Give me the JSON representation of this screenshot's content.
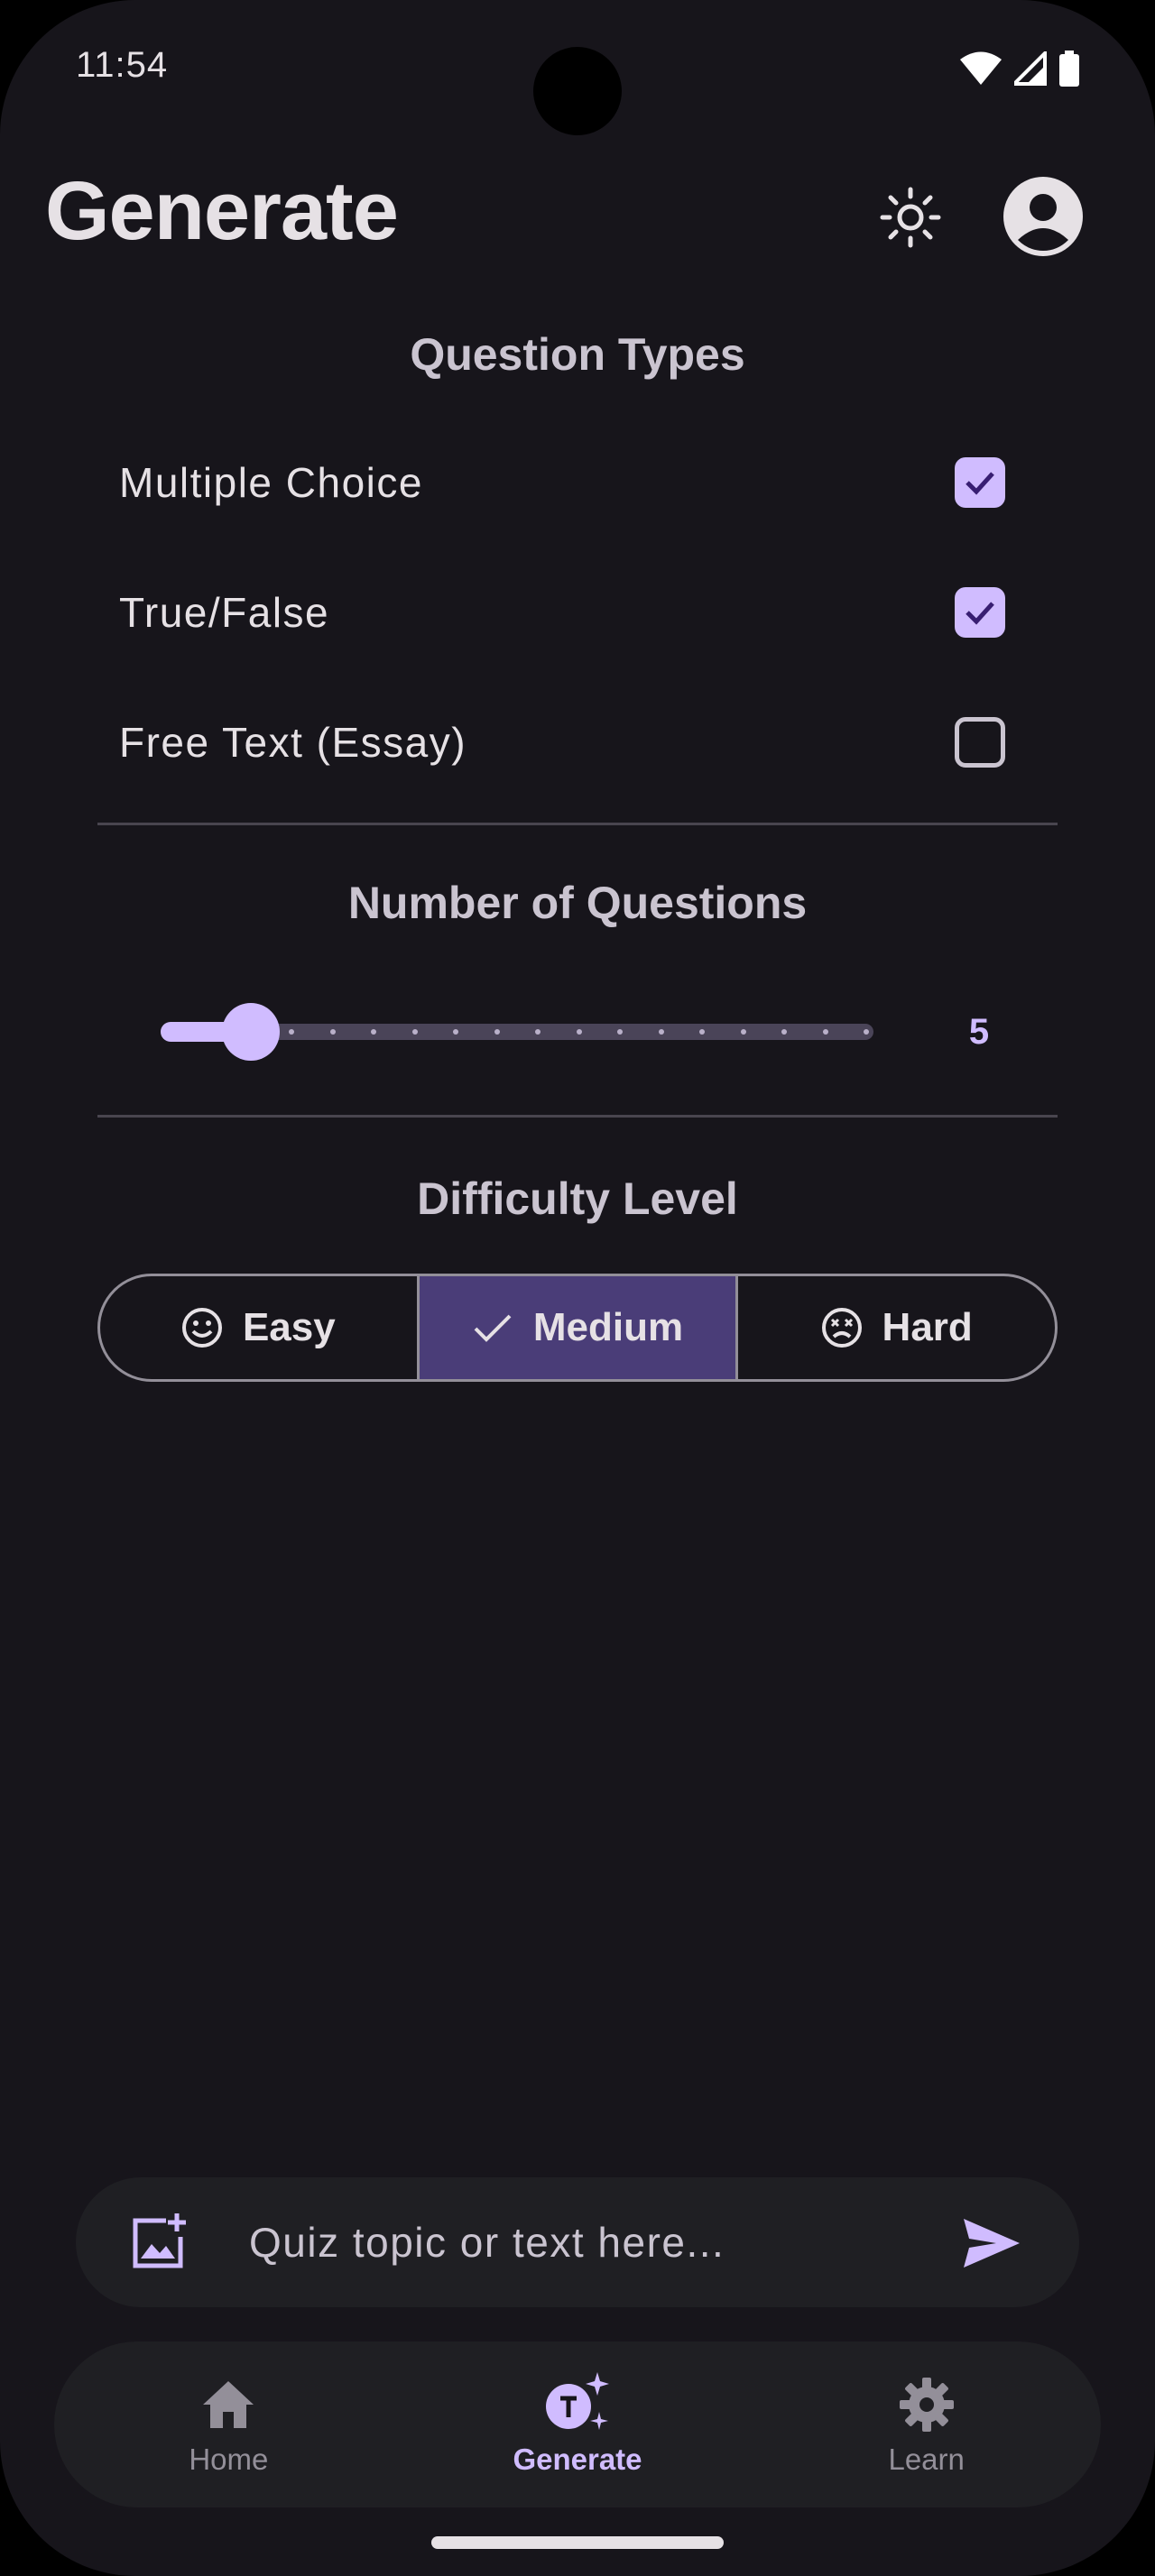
{
  "status_bar": {
    "time": "11:54",
    "icons": [
      "wifi-icon",
      "signal-icon",
      "battery-icon"
    ]
  },
  "header": {
    "title": "Generate",
    "theme_icon": "sun-icon",
    "profile_icon": "account-circle-icon"
  },
  "question_types": {
    "title": "Question Types",
    "options": [
      {
        "label": "Multiple Choice",
        "checked": true
      },
      {
        "label": "True/False",
        "checked": true
      },
      {
        "label": "Free Text (Essay)",
        "checked": false
      }
    ]
  },
  "number_of_questions": {
    "title": "Number of Questions",
    "value": "5",
    "min": 1,
    "max": 20
  },
  "difficulty": {
    "title": "Difficulty Level",
    "options": [
      {
        "label": "Easy",
        "icon": "smile-icon",
        "selected": false
      },
      {
        "label": "Medium",
        "icon": "check-icon",
        "selected": true
      },
      {
        "label": "Hard",
        "icon": "dizzy-face-icon",
        "selected": false
      }
    ]
  },
  "input": {
    "placeholder": "Quiz topic or text here...",
    "value": ""
  },
  "bottom_nav": {
    "items": [
      {
        "label": "Home",
        "icon": "home-icon",
        "active": false
      },
      {
        "label": "Generate",
        "icon": "text-sparkle-icon",
        "active": true
      },
      {
        "label": "Learn",
        "icon": "gear-icon",
        "active": false
      }
    ]
  },
  "colors": {
    "background": "#17151b",
    "accent": "#d0bcff",
    "selected_segment": "#4a3d78",
    "surface": "#1f1f23"
  }
}
